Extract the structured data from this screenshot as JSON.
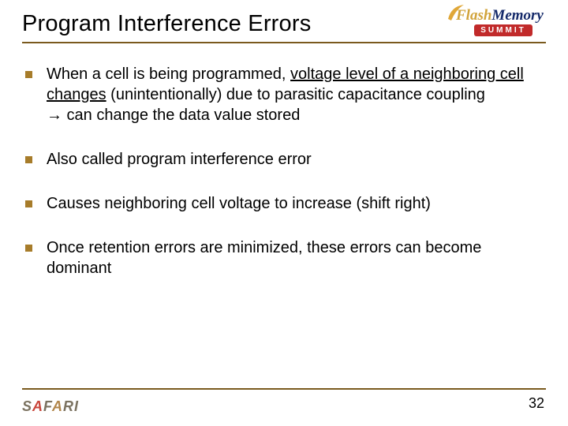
{
  "title": "Program Interference Errors",
  "logo_top": {
    "part1": "Flash",
    "part2": "Memory",
    "summit": "SUMMIT"
  },
  "bullets": [
    {
      "pre": "When a cell is being programmed, ",
      "under": "voltage level of a neighboring cell changes",
      "mid": " (unintentionally) due to parasitic capacitance coupling",
      "arrow": "→",
      "post": " can change the data value stored"
    },
    {
      "text": "Also called program interference error"
    },
    {
      "text": "Causes neighboring cell voltage to increase (shift right)"
    },
    {
      "text": "Once retention errors are minimized, these errors can become dominant"
    }
  ],
  "logo_bottom": "SAFARI",
  "page_number": "32"
}
